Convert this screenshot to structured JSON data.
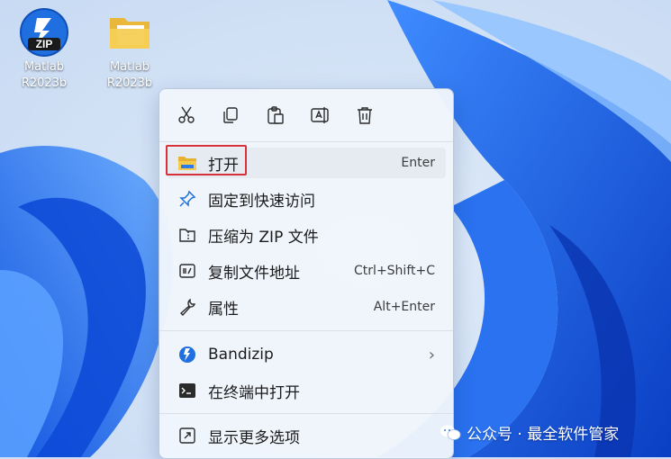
{
  "desktop": {
    "icons": [
      {
        "name": "Matlab",
        "subtitle": "R2023b",
        "badge": "ZIP"
      },
      {
        "name": "Matlab",
        "subtitle": "R2023b"
      }
    ]
  },
  "context_menu": {
    "toolbar": [
      "cut-icon",
      "copy-icon",
      "paste-icon",
      "rename-icon",
      "delete-icon"
    ],
    "items": [
      {
        "label": "打开",
        "shortcut": "Enter",
        "icon": "folder-icon"
      },
      {
        "label": "固定到快速访问",
        "shortcut": "",
        "icon": "pin-icon"
      },
      {
        "label": "压缩为 ZIP 文件",
        "shortcut": "",
        "icon": "zip-folder-icon"
      },
      {
        "label": "复制文件地址",
        "shortcut": "Ctrl+Shift+C",
        "icon": "copy-path-icon"
      },
      {
        "label": "属性",
        "shortcut": "Alt+Enter",
        "icon": "wrench-icon"
      },
      {
        "label": "Bandizip",
        "shortcut": "",
        "icon": "bandizip-icon",
        "submenu": true
      },
      {
        "label": "在终端中打开",
        "shortcut": "",
        "icon": "terminal-icon"
      },
      {
        "label": "显示更多选项",
        "shortcut": "",
        "icon": "more-options-icon"
      }
    ],
    "submenu_arrow": "›"
  },
  "watermark": {
    "text": "公众号 · 最全软件管家"
  },
  "colors": {
    "highlight_border": "#d8313b",
    "wallpaper_blue": "#1a63e8"
  }
}
